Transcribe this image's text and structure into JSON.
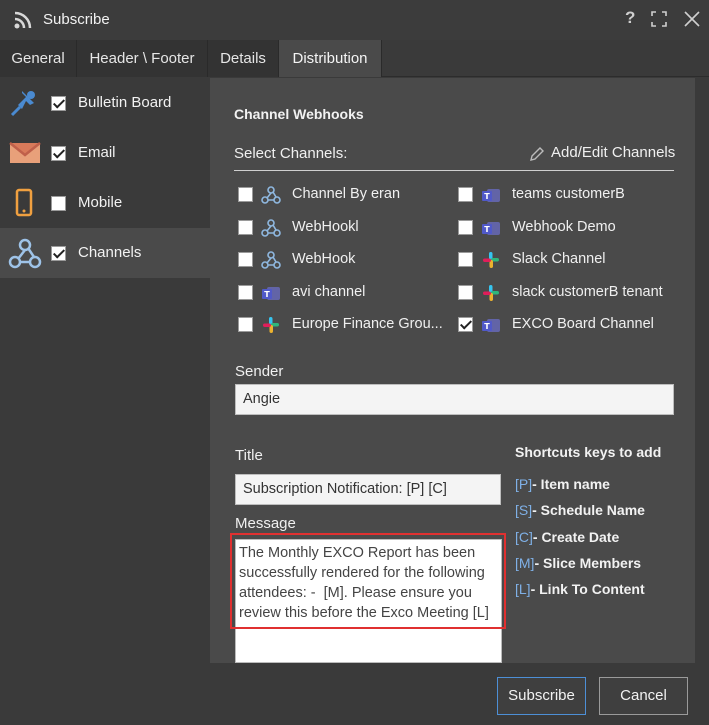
{
  "window": {
    "title": "Subscribe",
    "help": "?",
    "maximize": "⛶",
    "close": "✕"
  },
  "tabs": [
    {
      "label": "General"
    },
    {
      "label": "Header \\ Footer"
    },
    {
      "label": "Details"
    },
    {
      "label": "Distribution"
    }
  ],
  "sidebar": {
    "items": [
      {
        "label": "Bulletin Board",
        "checked": true
      },
      {
        "label": "Email",
        "checked": true
      },
      {
        "label": "Mobile",
        "checked": false
      },
      {
        "label": "Channels",
        "checked": true
      }
    ]
  },
  "webhooks": {
    "heading": "Channel Webhooks",
    "select_label": "Select Channels:",
    "add_edit": "Add/Edit Channels",
    "channels_left": [
      {
        "label": "Channel By eran",
        "type": "webhook",
        "checked": false
      },
      {
        "label": "WebHookl",
        "type": "webhook",
        "checked": false
      },
      {
        "label": "WebHook",
        "type": "webhook",
        "checked": false
      },
      {
        "label": "avi channel",
        "type": "teams",
        "checked": false
      },
      {
        "label": "Europe Finance Grou...",
        "type": "slack",
        "checked": false
      }
    ],
    "channels_right": [
      {
        "label": "teams customerB",
        "type": "teams",
        "checked": false
      },
      {
        "label": "Webhook Demo",
        "type": "teams",
        "checked": false
      },
      {
        "label": "Slack Channel",
        "type": "slack",
        "checked": false
      },
      {
        "label": "slack customerB tenant",
        "type": "slack",
        "checked": false
      },
      {
        "label": "EXCO Board Channel",
        "type": "teams",
        "checked": true
      }
    ]
  },
  "sender": {
    "label": "Sender",
    "value": "Angie"
  },
  "title_field": {
    "label": "Title",
    "value": "Subscription Notification: [P] [C]"
  },
  "message": {
    "label": "Message",
    "value": "The Monthly EXCO Report has been successfully rendered for the following attendees: -  [M]. Please ensure you review this before the Exco Meeting [L]"
  },
  "shortcuts": {
    "heading": "Shortcuts keys to add",
    "items": [
      {
        "key": "[P]",
        "label": "- Item name"
      },
      {
        "key": "[S]",
        "label": "- Schedule Name"
      },
      {
        "key": "[C]",
        "label": "- Create Date"
      },
      {
        "key": "[M]",
        "label": "- Slice Members"
      },
      {
        "key": "[L]",
        "label": "- Link To Content"
      }
    ]
  },
  "buttons": {
    "subscribe": "Subscribe",
    "cancel": "Cancel"
  }
}
